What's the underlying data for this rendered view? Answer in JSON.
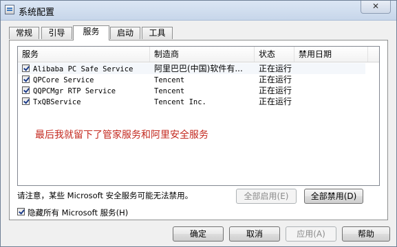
{
  "window": {
    "title": "系统配置",
    "close_label": "✕"
  },
  "tabs": [
    "常规",
    "引导",
    "服务",
    "启动",
    "工具"
  ],
  "list": {
    "columns": [
      "服务",
      "制造商",
      "状态",
      "禁用日期"
    ],
    "rows": [
      {
        "service": "Alibaba PC Safe Service",
        "maker": "阿里巴巴(中国)软件有...",
        "status": "正在运行",
        "date": ""
      },
      {
        "service": "QPCore Service",
        "maker": "Tencent",
        "status": "正在运行",
        "date": ""
      },
      {
        "service": "QQPCMgr RTP Service",
        "maker": "Tencent",
        "status": "正在运行",
        "date": ""
      },
      {
        "service": "TxQBService",
        "maker": "Tencent Inc.",
        "status": "正在运行",
        "date": ""
      }
    ]
  },
  "annotation": "最后我就留下了管家服务和阿里安全服务",
  "warning_text": "请注意，某些 Microsoft 安全服务可能无法禁用。",
  "buttons": {
    "enable_all": "全部启用(E)",
    "disable_all": "全部禁用(D)",
    "ok": "确定",
    "cancel": "取消",
    "apply": "应用(A)",
    "help": "帮助"
  },
  "hide_ms_label": "隐藏所有 Microsoft 服务(H)"
}
